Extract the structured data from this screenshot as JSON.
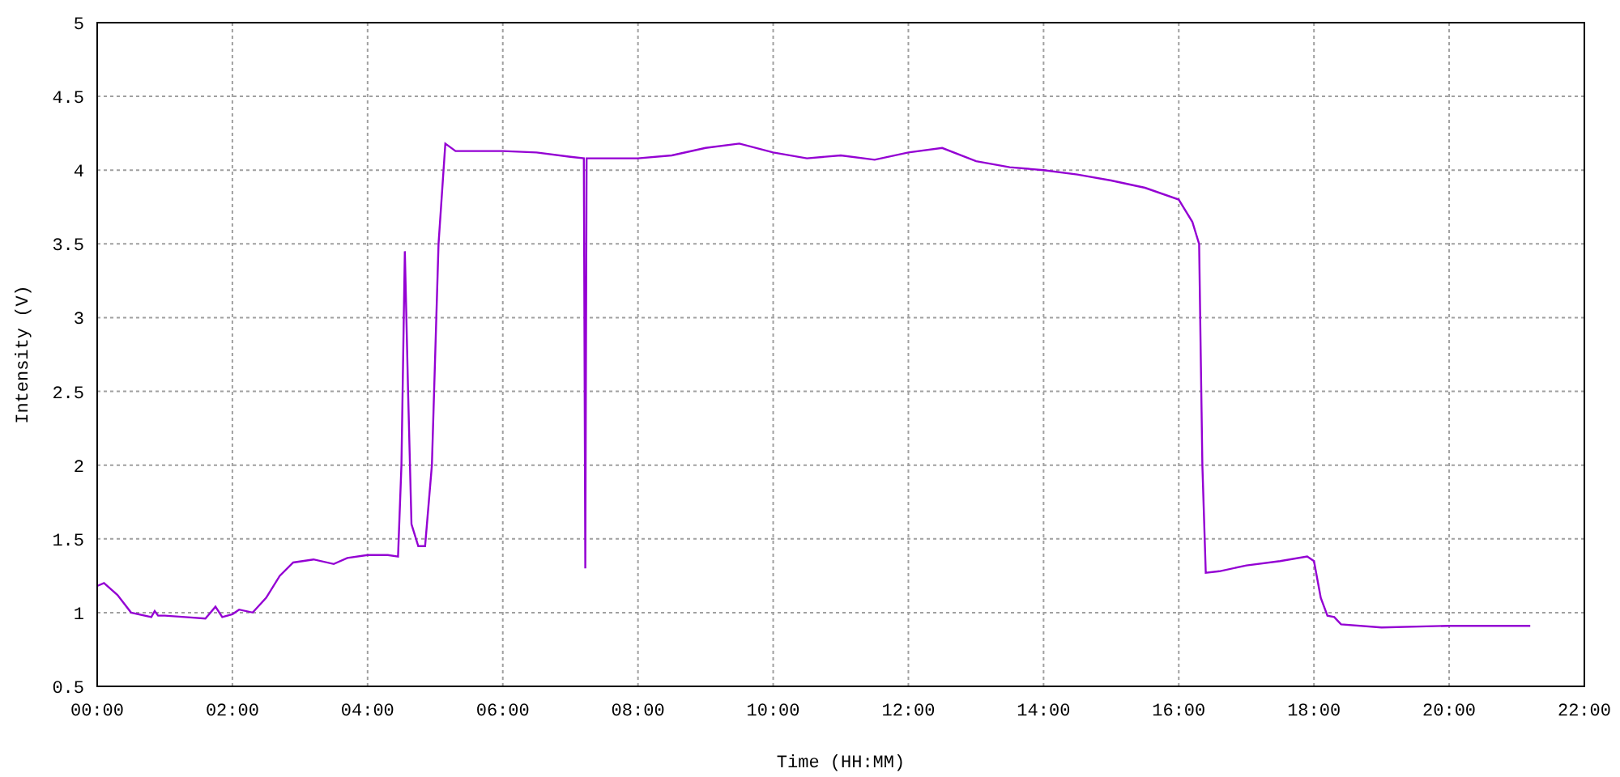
{
  "chart": {
    "chart_data": {
      "type": "line",
      "xlabel": "Time (HH:MM)",
      "ylabel": "Intensity (V)",
      "x": [
        0,
        0.1,
        0.3,
        0.5,
        0.8,
        0.85,
        0.9,
        1.0,
        1.3,
        1.6,
        1.75,
        1.85,
        2.0,
        2.1,
        2.3,
        2.5,
        2.7,
        2.9,
        3.2,
        3.5,
        3.7,
        4.0,
        4.3,
        4.45,
        4.5,
        4.55,
        4.6,
        4.65,
        4.75,
        4.85,
        4.95,
        5.05,
        5.15,
        5.3,
        6,
        6.5,
        7,
        7.2,
        7.22,
        7.24,
        7.5,
        8,
        8.5,
        9,
        9.5,
        10,
        10.5,
        11,
        11.5,
        12,
        12.5,
        13,
        13.5,
        14,
        14.5,
        15,
        15.5,
        16,
        16.2,
        16.3,
        16.35,
        16.4,
        16.6,
        17,
        17.5,
        17.9,
        18.0,
        18.1,
        18.2,
        18.3,
        18.4,
        19,
        20,
        21,
        21.2
      ],
      "grid": true,
      "series": [
        {
          "color": "#9400d3",
          "values": [
            1.18,
            1.2,
            1.12,
            1.0,
            0.97,
            1.01,
            0.98,
            0.98,
            0.97,
            0.96,
            1.04,
            0.97,
            0.99,
            1.02,
            1.0,
            1.1,
            1.25,
            1.34,
            1.36,
            1.33,
            1.37,
            1.39,
            1.39,
            1.38,
            2.0,
            3.45,
            2.5,
            1.6,
            1.45,
            1.45,
            2.0,
            3.5,
            4.18,
            4.13,
            4.13,
            4.12,
            4.09,
            4.08,
            1.3,
            4.08,
            4.08,
            4.08,
            4.1,
            4.15,
            4.18,
            4.12,
            4.08,
            4.1,
            4.07,
            4.12,
            4.15,
            4.06,
            4.02,
            4.0,
            3.97,
            3.93,
            3.88,
            3.8,
            3.65,
            3.5,
            2.0,
            1.27,
            1.28,
            1.32,
            1.35,
            1.38,
            1.35,
            1.1,
            0.98,
            0.97,
            0.92,
            0.9,
            0.91,
            0.91,
            0.91
          ]
        }
      ],
      "xlim": [
        0,
        22
      ],
      "ylim": [
        0.5,
        5
      ],
      "xticks": [
        {
          "value": 0,
          "label": "00:00"
        },
        {
          "value": 2,
          "label": "02:00"
        },
        {
          "value": 4,
          "label": "04:00"
        },
        {
          "value": 6,
          "label": "06:00"
        },
        {
          "value": 8,
          "label": "08:00"
        },
        {
          "value": 10,
          "label": "10:00"
        },
        {
          "value": 12,
          "label": "12:00"
        },
        {
          "value": 14,
          "label": "14:00"
        },
        {
          "value": 16,
          "label": "16:00"
        },
        {
          "value": 18,
          "label": "18:00"
        },
        {
          "value": 20,
          "label": "20:00"
        },
        {
          "value": 22,
          "label": "22:00"
        }
      ],
      "yticks": [
        {
          "value": 0.5,
          "label": "0.5"
        },
        {
          "value": 1,
          "label": "1"
        },
        {
          "value": 1.5,
          "label": "1.5"
        },
        {
          "value": 2,
          "label": "2"
        },
        {
          "value": 2.5,
          "label": "2.5"
        },
        {
          "value": 3,
          "label": "3"
        },
        {
          "value": 3.5,
          "label": "3.5"
        },
        {
          "value": 4,
          "label": "4"
        },
        {
          "value": 4.5,
          "label": "4.5"
        },
        {
          "value": 5,
          "label": "5"
        }
      ]
    }
  }
}
